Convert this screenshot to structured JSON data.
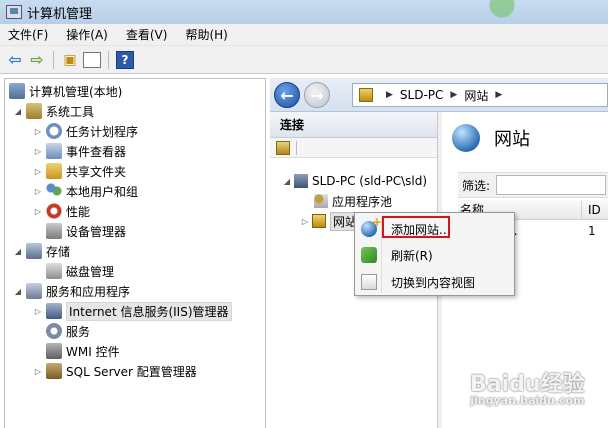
{
  "window": {
    "title": "计算机管理"
  },
  "menu": [
    "文件(F)",
    "操作(A)",
    "查看(V)",
    "帮助(H)"
  ],
  "left_tree": [
    {
      "label": "计算机管理(本地)",
      "icon": "computer-icon",
      "expander": ""
    },
    {
      "label": "系统工具",
      "icon": "tools-icon",
      "expander": "◢"
    },
    {
      "label": "任务计划程序",
      "icon": "clock-icon",
      "expander": "▷"
    },
    {
      "label": "事件查看器",
      "icon": "event-log-icon",
      "expander": "▷"
    },
    {
      "label": "共享文件夹",
      "icon": "shared-folder-icon",
      "expander": "▷"
    },
    {
      "label": "本地用户和组",
      "icon": "users-icon",
      "expander": "▷"
    },
    {
      "label": "性能",
      "icon": "performance-icon",
      "expander": "▷"
    },
    {
      "label": "设备管理器",
      "icon": "device-manager-icon",
      "expander": ""
    },
    {
      "label": "存储",
      "icon": "storage-icon",
      "expander": "◢"
    },
    {
      "label": "磁盘管理",
      "icon": "disk-icon",
      "expander": ""
    },
    {
      "label": "服务和应用程序",
      "icon": "services-apps-icon",
      "expander": "◢"
    },
    {
      "label": "Internet 信息服务(IIS)管理器",
      "icon": "iis-icon",
      "expander": "▷"
    },
    {
      "label": "服务",
      "icon": "gear-icon",
      "expander": ""
    },
    {
      "label": "WMI 控件",
      "icon": "wmi-icon",
      "expander": ""
    },
    {
      "label": "SQL Server 配置管理器",
      "icon": "sql-icon",
      "expander": "▷"
    }
  ],
  "address": {
    "segments": [
      "SLD-PC",
      "网站"
    ]
  },
  "connections": {
    "header": "连接",
    "tree": [
      {
        "label": "SLD-PC (sld-PC\\sld)",
        "expander": "◢"
      },
      {
        "label": "应用程序池",
        "expander": ""
      },
      {
        "label": "网站",
        "expander": "▷"
      }
    ]
  },
  "sites_panel": {
    "title": "网站",
    "filter_label": "筛选:",
    "columns": [
      "名称",
      "ID"
    ],
    "rows": [
      {
        "name": "t Web S...",
        "id": "1"
      }
    ]
  },
  "context_menu": {
    "items": [
      {
        "label": "添加网站...",
        "icon": "add-website-icon"
      },
      {
        "label": "刷新(R)",
        "icon": "refresh-icon"
      },
      {
        "label": "切换到内容视图",
        "icon": "content-view-icon"
      }
    ]
  },
  "watermark": {
    "text": "Baidu经验",
    "sub": "jingyan.baidu.com"
  },
  "colors": {
    "highlight": "#d4161b",
    "accent": "#2b6fb3"
  }
}
